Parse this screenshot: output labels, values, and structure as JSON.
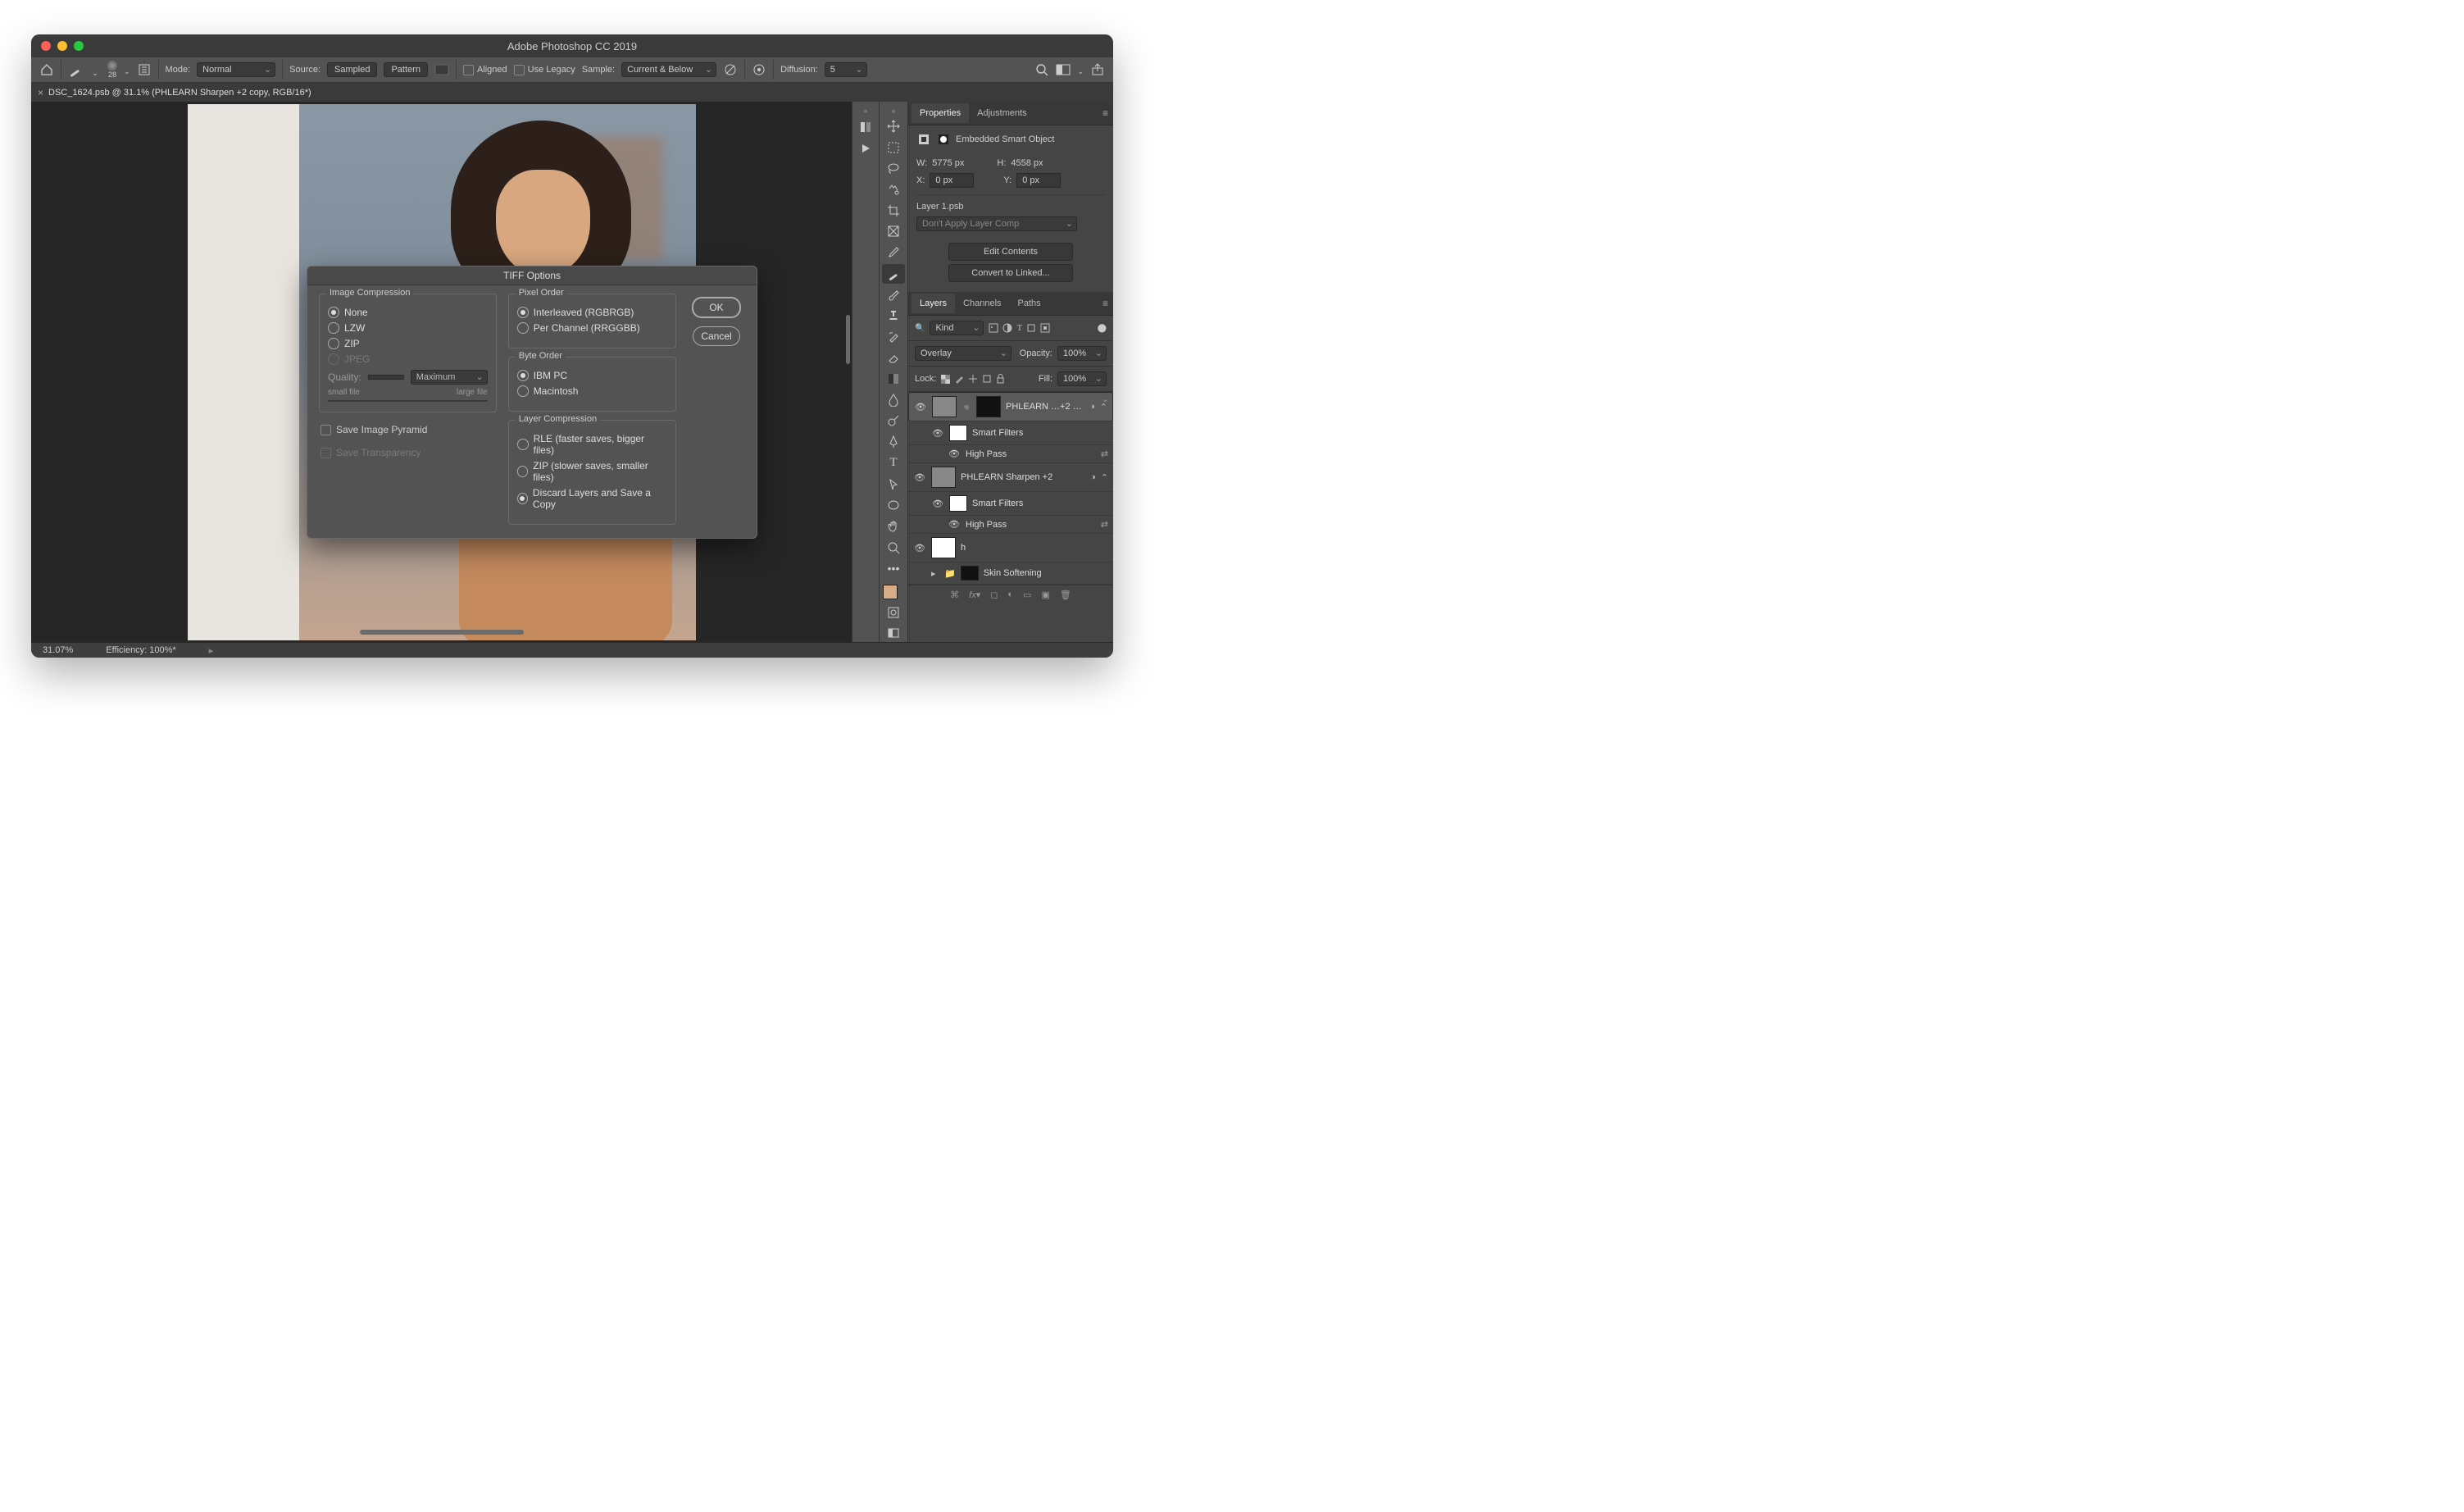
{
  "window": {
    "title": "Adobe Photoshop CC 2019"
  },
  "optionsBar": {
    "brushSize": "28",
    "modeLabel": "Mode:",
    "modeValue": "Normal",
    "sourceLabel": "Source:",
    "sourceSampled": "Sampled",
    "sourcePattern": "Pattern",
    "alignedLabel": "Aligned",
    "useLegacyLabel": "Use Legacy",
    "sampleLabel": "Sample:",
    "sampleValue": "Current & Below",
    "diffusionLabel": "Diffusion:",
    "diffusionValue": "5"
  },
  "documentTab": {
    "label": "DSC_1624.psb @ 31.1% (PHLEARN Sharpen +2 copy, RGB/16*)"
  },
  "statusBar": {
    "zoom": "31.07%",
    "efficiency": "Efficiency: 100%*"
  },
  "propertiesPanel": {
    "tabs": {
      "properties": "Properties",
      "adjustments": "Adjustments"
    },
    "typeLabel": "Embedded Smart Object",
    "wLabel": "W:",
    "wValue": "5775 px",
    "hLabel": "H:",
    "hValue": "4558 px",
    "xLabel": "X:",
    "xValue": "0 px",
    "yLabel": "Y:",
    "yValue": "0 px",
    "sourceFile": "Layer 1.psb",
    "layerCompValue": "Don't Apply Layer Comp",
    "editBtn": "Edit Contents",
    "convertBtn": "Convert to Linked..."
  },
  "layersPanel": {
    "tabs": {
      "layers": "Layers",
      "channels": "Channels",
      "paths": "Paths"
    },
    "kindLabel": "Kind",
    "blendMode": "Overlay",
    "opacityLabel": "Opacity:",
    "opacityValue": "100%",
    "lockLabel": "Lock:",
    "fillLabel": "Fill:",
    "fillValue": "100%",
    "items": [
      {
        "name": "PHLEARN …+2 copy",
        "smartFilters": "Smart Filters",
        "filter": "High Pass"
      },
      {
        "name": "PHLEARN Sharpen +2",
        "smartFilters": "Smart Filters",
        "filter": "High Pass"
      },
      {
        "name": "h"
      },
      {
        "name": "Skin Softening"
      }
    ]
  },
  "dialog": {
    "title": "TIFF Options",
    "imageCompression": {
      "title": "Image Compression",
      "none": "None",
      "lzw": "LZW",
      "zip": "ZIP",
      "jpeg": "JPEG",
      "qualityLabel": "Quality:",
      "qualityPreset": "Maximum",
      "smallFile": "small file",
      "largeFile": "large file"
    },
    "savePyramid": "Save Image Pyramid",
    "saveTransparency": "Save Transparency",
    "pixelOrder": {
      "title": "Pixel Order",
      "interleaved": "Interleaved (RGBRGB)",
      "perChannel": "Per Channel (RRGGBB)"
    },
    "byteOrder": {
      "title": "Byte Order",
      "ibm": "IBM PC",
      "mac": "Macintosh"
    },
    "layerCompression": {
      "title": "Layer Compression",
      "rle": "RLE (faster saves, bigger files)",
      "zip": "ZIP (slower saves, smaller files)",
      "discard": "Discard Layers and Save a Copy"
    },
    "ok": "OK",
    "cancel": "Cancel"
  },
  "colors": {
    "trafficRed": "#ff5f57",
    "trafficYellow": "#febc2e",
    "trafficGreen": "#28c840"
  }
}
